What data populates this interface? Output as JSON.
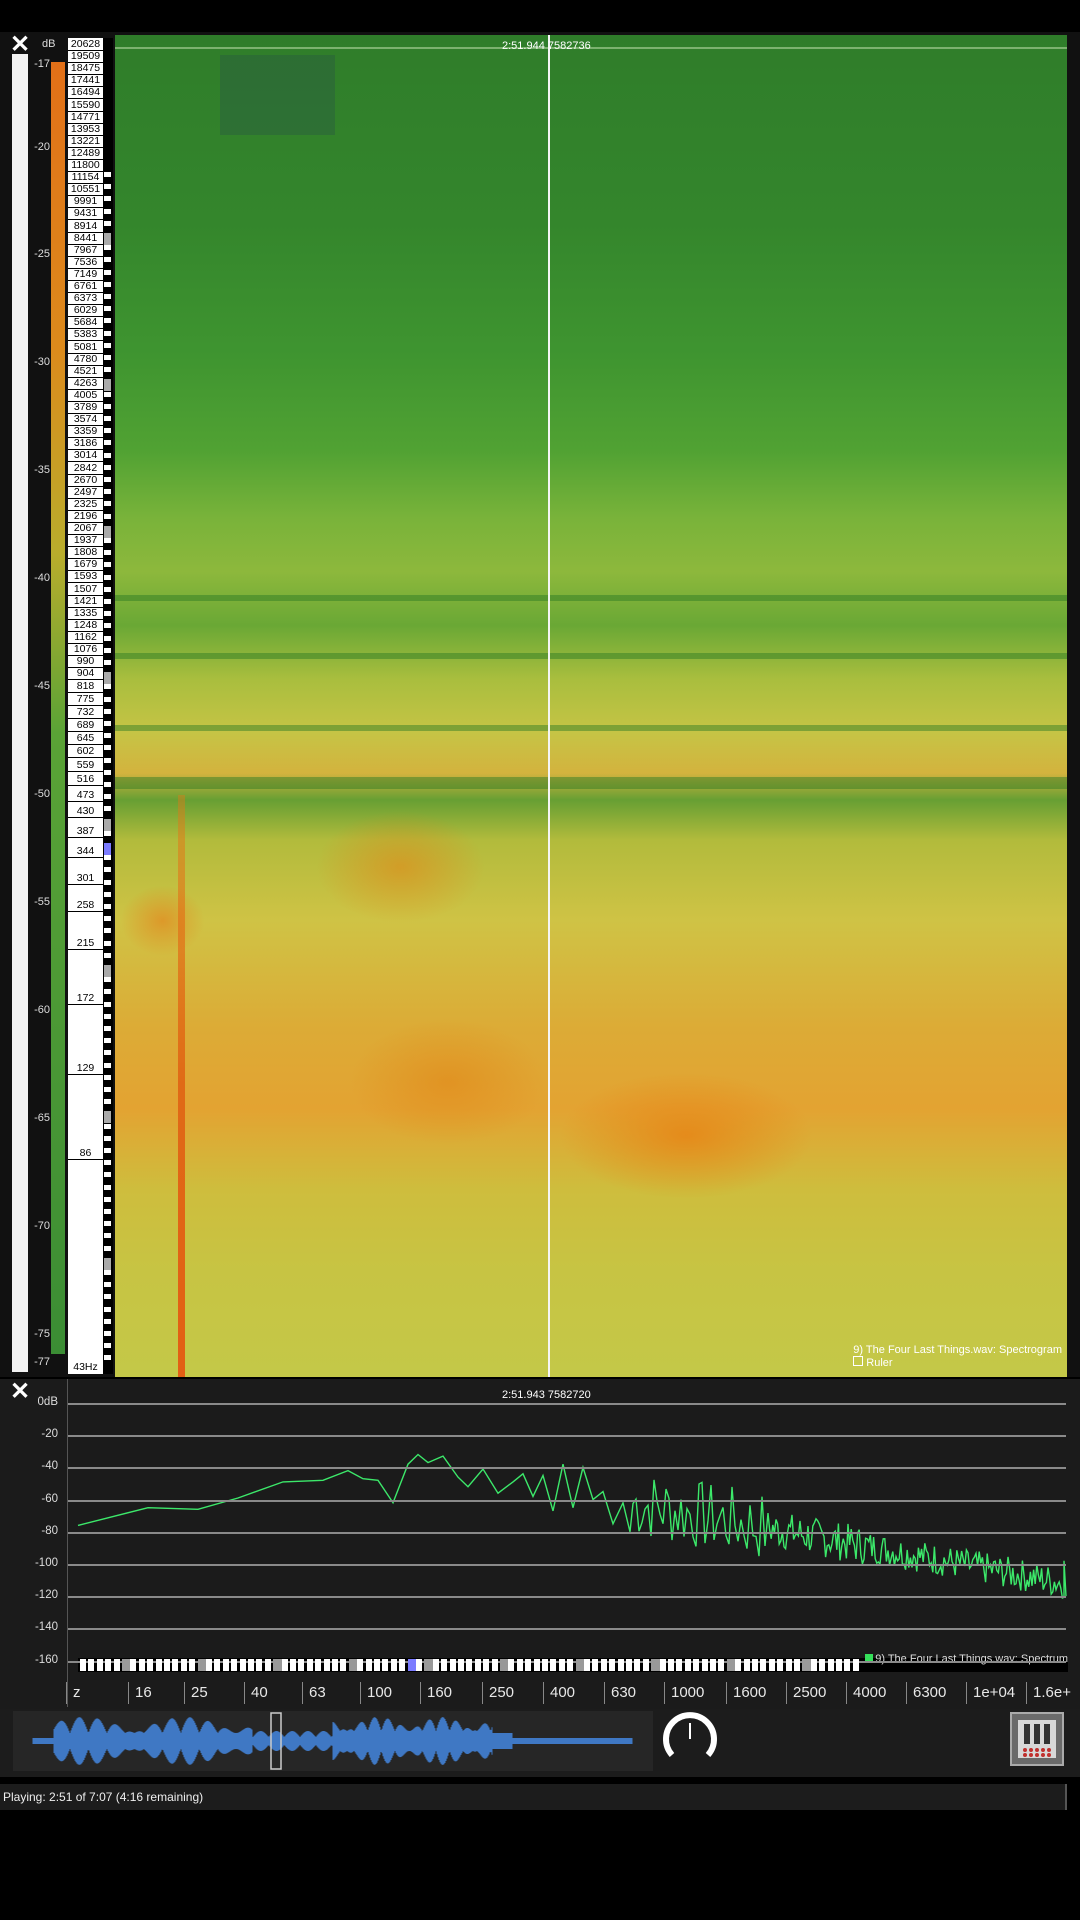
{
  "spectrogram": {
    "db_unit": "dB",
    "db_ticks": [
      "-17",
      "-20",
      "-25",
      "-30",
      "-35",
      "-40",
      "-45",
      "-50",
      "-55",
      "-60",
      "-65",
      "-70",
      "-75",
      "-77"
    ],
    "freq_labels": [
      "20628",
      "19509",
      "18475",
      "17441",
      "16494",
      "15590",
      "14771",
      "13953",
      "13221",
      "12489",
      "11800",
      "11154",
      "10551",
      "9991",
      "9431",
      "8914",
      "8441",
      "7967",
      "7536",
      "7149",
      "6761",
      "6373",
      "6029",
      "5684",
      "5383",
      "5081",
      "4780",
      "4521",
      "4263",
      "4005",
      "3789",
      "3574",
      "3359",
      "3186",
      "3014",
      "2842",
      "2670",
      "2497",
      "2325",
      "2196",
      "2067",
      "1937",
      "1808",
      "1679",
      "1593",
      "1507",
      "1421",
      "1335",
      "1248",
      "1162",
      "1076",
      "990",
      "904",
      "818",
      "775",
      "732",
      "689",
      "645",
      "602",
      "559",
      "516",
      "473",
      "430",
      "387",
      "344",
      "301",
      "258",
      "215",
      "172",
      "129",
      "86"
    ],
    "freq_bottom": "43Hz",
    "playhead_readout": "2:51.944   7582736",
    "legend_title": "9) The Four Last Things.wav: Spectrogram",
    "legend_ruler": "Ruler"
  },
  "spectrum": {
    "readout": "2:51.943   7582720",
    "y_labels": [
      "0dB",
      "-20",
      "-40",
      "-60",
      "-80",
      "-100",
      "-120",
      "-140",
      "-160"
    ],
    "x_labels": [
      "z",
      "16",
      "25",
      "40",
      "63",
      "100",
      "160",
      "250",
      "400",
      "630",
      "1000",
      "1600",
      "2500",
      "4000",
      "6300",
      "1e+04",
      "1.6e+"
    ],
    "legend": "9) The Four Last Things.wav: Spectrum",
    "line_color": "#3ce86a"
  },
  "status": {
    "text": "Playing: 2:51 of 7:07 (4:16 remaining)"
  }
}
